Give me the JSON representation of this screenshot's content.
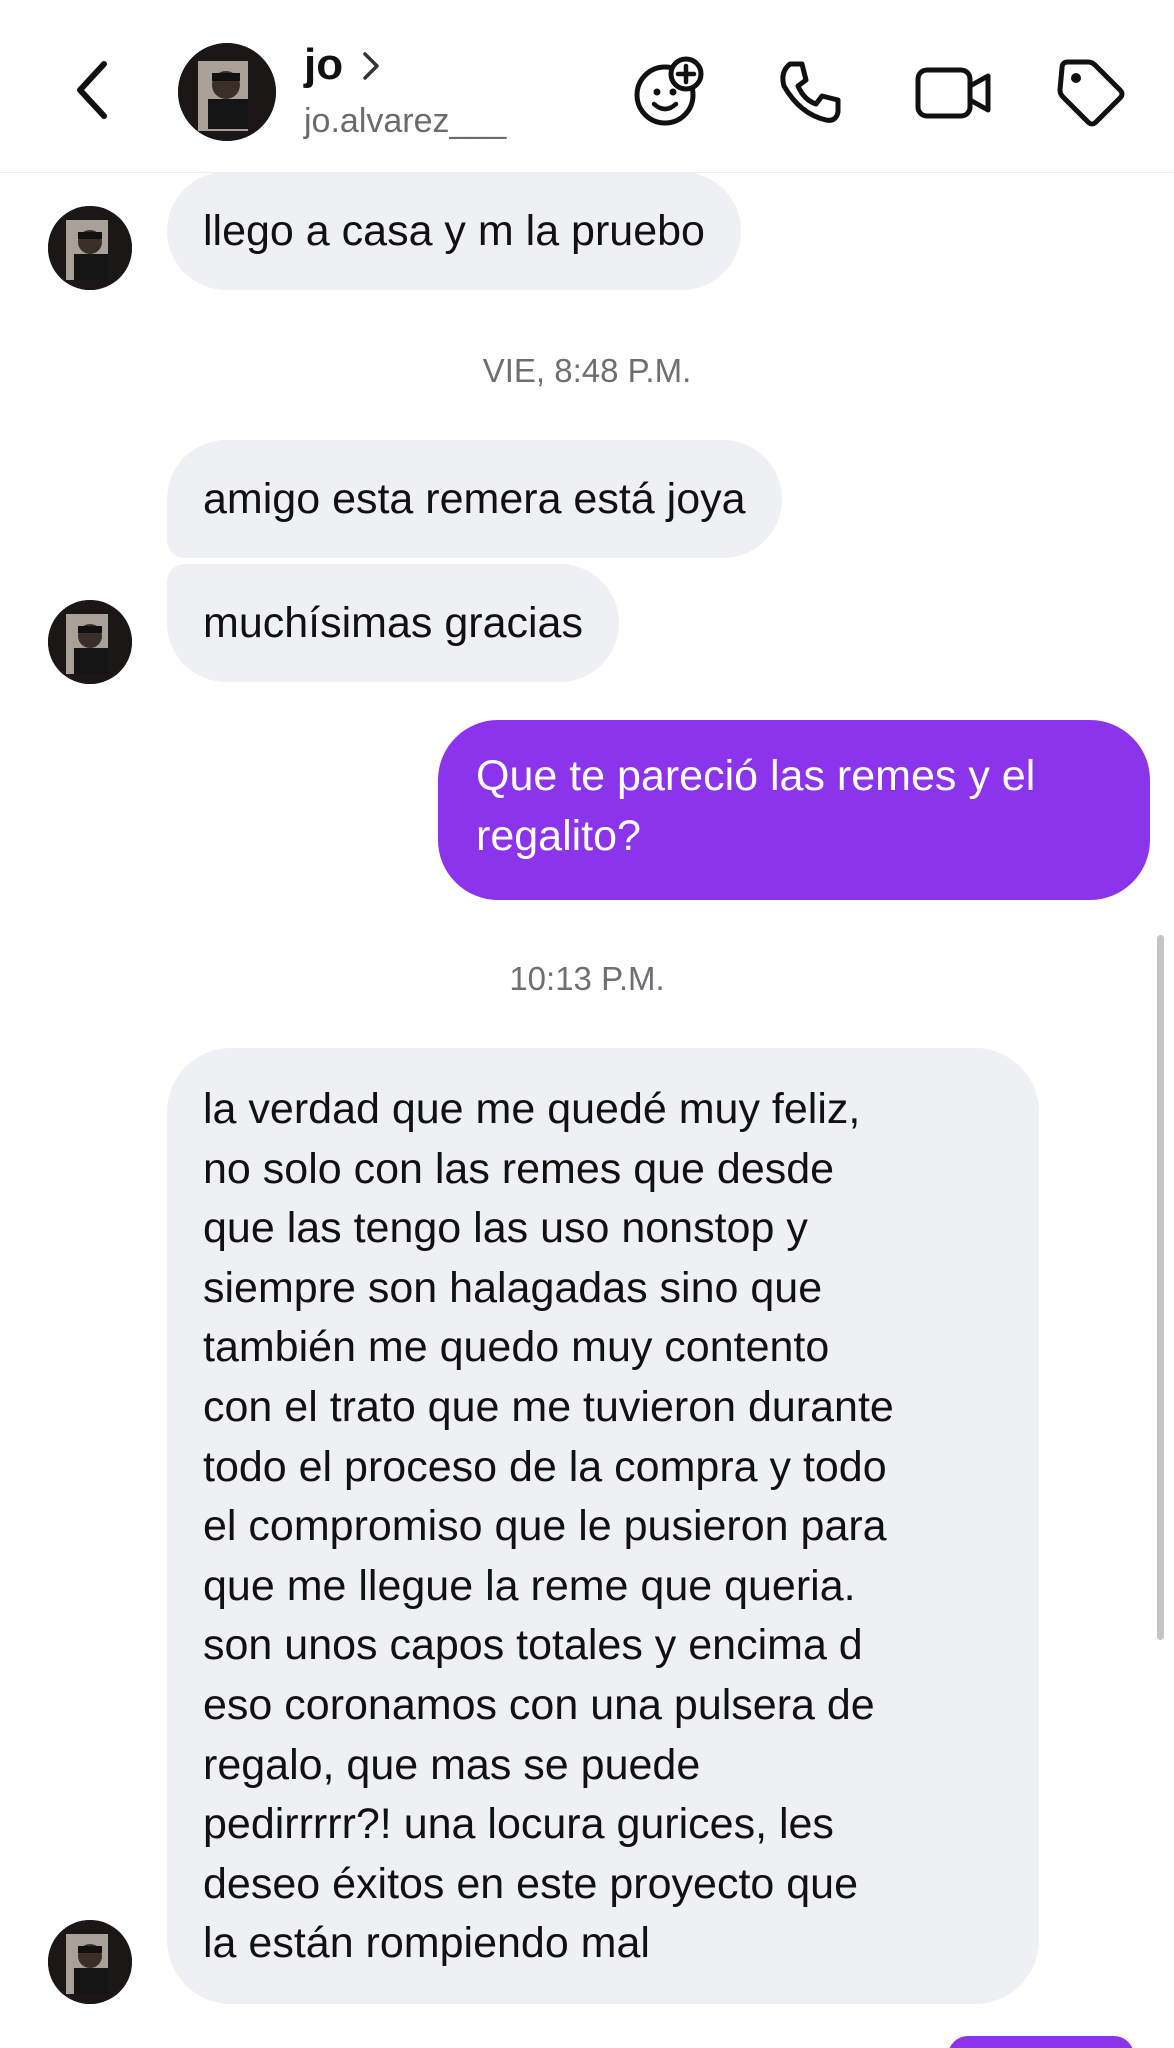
{
  "header": {
    "name": "jo",
    "username": "jo.alvarez___",
    "icons": [
      "back-chevron-icon",
      "chevron-right-icon",
      "sticker-add-icon",
      "phone-icon",
      "video-icon",
      "tag-icon"
    ]
  },
  "messages": {
    "m1": "llego a casa y m la pruebo",
    "ts1": "VIE, 8:48 P.M.",
    "m2": "amigo esta remera está joya",
    "m3": "muchísimas gracias",
    "out1_line1": "Que te pareció las remes y el",
    "out1_line2": "regalito?",
    "ts2": "10:13 P.M.",
    "long_lines": [
      "la verdad que me quedé muy feliz,",
      "no solo con las remes que desde",
      "que las tengo las uso nonstop y",
      "siempre son halagadas sino que",
      "también me quedo muy contento",
      "con el trato que me tuvieron durante",
      "todo el proceso de la compra y todo",
      "el compromiso que le pusieron para",
      "que me llegue la reme que queria.",
      "son unos capos totales y encima d",
      "eso coronamos con una pulsera de",
      "regalo, que mas se puede",
      "pedirrrrr?! una locura gurices, les",
      "deseo éxitos en este proyecto que",
      "la están rompiendo mal"
    ]
  },
  "colors": {
    "outgoing_bubble": "#8b34ec",
    "incoming_bubble": "#eff0f3",
    "timestamp_text": "#6e6e73"
  }
}
